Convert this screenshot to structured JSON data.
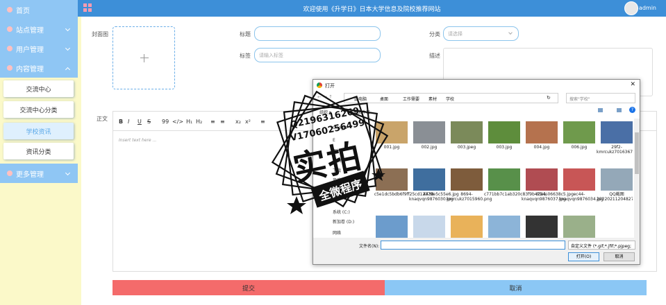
{
  "sidebar": {
    "home": "首页",
    "site": "站点管理",
    "user": "用户管理",
    "content": "内容管理",
    "subs": [
      "交流中心",
      "交流中心分类",
      "学校资讯",
      "资讯分类"
    ],
    "more": "更多管理"
  },
  "topbar": {
    "title": "欢迎使用《升学日》日本大学信息及院校推荐网站",
    "user": "admin"
  },
  "form": {
    "cover_label": "封面图",
    "title_label": "标题",
    "tag_label": "标签",
    "tag_placeholder": "请输入标签",
    "category_label": "分类",
    "category_placeholder": "请选择",
    "desc_label": "描述",
    "body_label": "正文",
    "editor_placeholder": "Insert text here ...",
    "toolbar": [
      "B",
      "I",
      "U",
      "S",
      "99",
      "</>",
      "H₁",
      "H₂",
      "≡",
      "≡",
      "x₂",
      "x²",
      "≡"
    ],
    "submit": "提交",
    "cancel": "取消"
  },
  "dialog": {
    "title": "打开",
    "breadcrumb": [
      "此电脑",
      "桌面",
      "工作需要",
      "素材",
      "学校"
    ],
    "search_placeholder": "搜索\"学校\"",
    "organize": "组织 ▾",
    "new_folder": "新建文件夹",
    "tree": [
      "Google",
      "E",
      "图片",
      "文档",
      "下载",
      "音乐",
      "桌面",
      "系统 (C:)",
      "新加卷 (D:)",
      "网络"
    ],
    "files": [
      {
        "name": "001.jpg",
        "color": "#c9a46a"
      },
      {
        "name": "002.jpg",
        "color": "#8a8f95"
      },
      {
        "name": "003.jpeg",
        "color": "#7b8a5a"
      },
      {
        "name": "003.jpg",
        "color": "#5e8d3c"
      },
      {
        "name": "004.jpg",
        "color": "#b5724e"
      },
      {
        "name": "006.jpg",
        "color": "#6f9a4c"
      },
      {
        "name": "29f2-kmrcukz7016367.png",
        "color": "#4a6fa6"
      },
      {
        "name": "3c5e1dc5bdb6f9ff25cd12379e5c55e6.jpg",
        "color": "#8c6f54"
      },
      {
        "name": "4438-knaqvqn9876030.jpg",
        "color": "#3f6e9e"
      },
      {
        "name": "8694-kmrcukz7015960.png",
        "color": "#7e5c3c"
      },
      {
        "name": "c771bb7c1ab320c83f9b4734c06638c5.jpg",
        "color": "#58904a"
      },
      {
        "name": "dde1-knaqvqn9876037.jpg",
        "color": "#b04c52"
      },
      {
        "name": "ec44-knaqvqn9876034.jpg",
        "color": "#c85656"
      },
      {
        "name": "QQ截图20220211204827.png",
        "color": "#94a8b8"
      },
      {
        "name": "",
        "color": "#6c9ccc"
      },
      {
        "name": "",
        "color": "#c8d8ea"
      },
      {
        "name": "",
        "color": "#e9b25a"
      },
      {
        "name": "",
        "color": "#8cb4d8"
      },
      {
        "name": "",
        "color": "#333333"
      },
      {
        "name": "",
        "color": "#9ab08a"
      }
    ],
    "filename_label": "文件名(N):",
    "filetype": "自定义文件 (*.gif;*.jfif;*.pjpeg;",
    "open": "打开(O)",
    "cancel": "取消"
  },
  "watermark": {
    "qq": "Q2196316269",
    "v": "V17060256499",
    "main": "实拍",
    "sub": "全微程序"
  }
}
